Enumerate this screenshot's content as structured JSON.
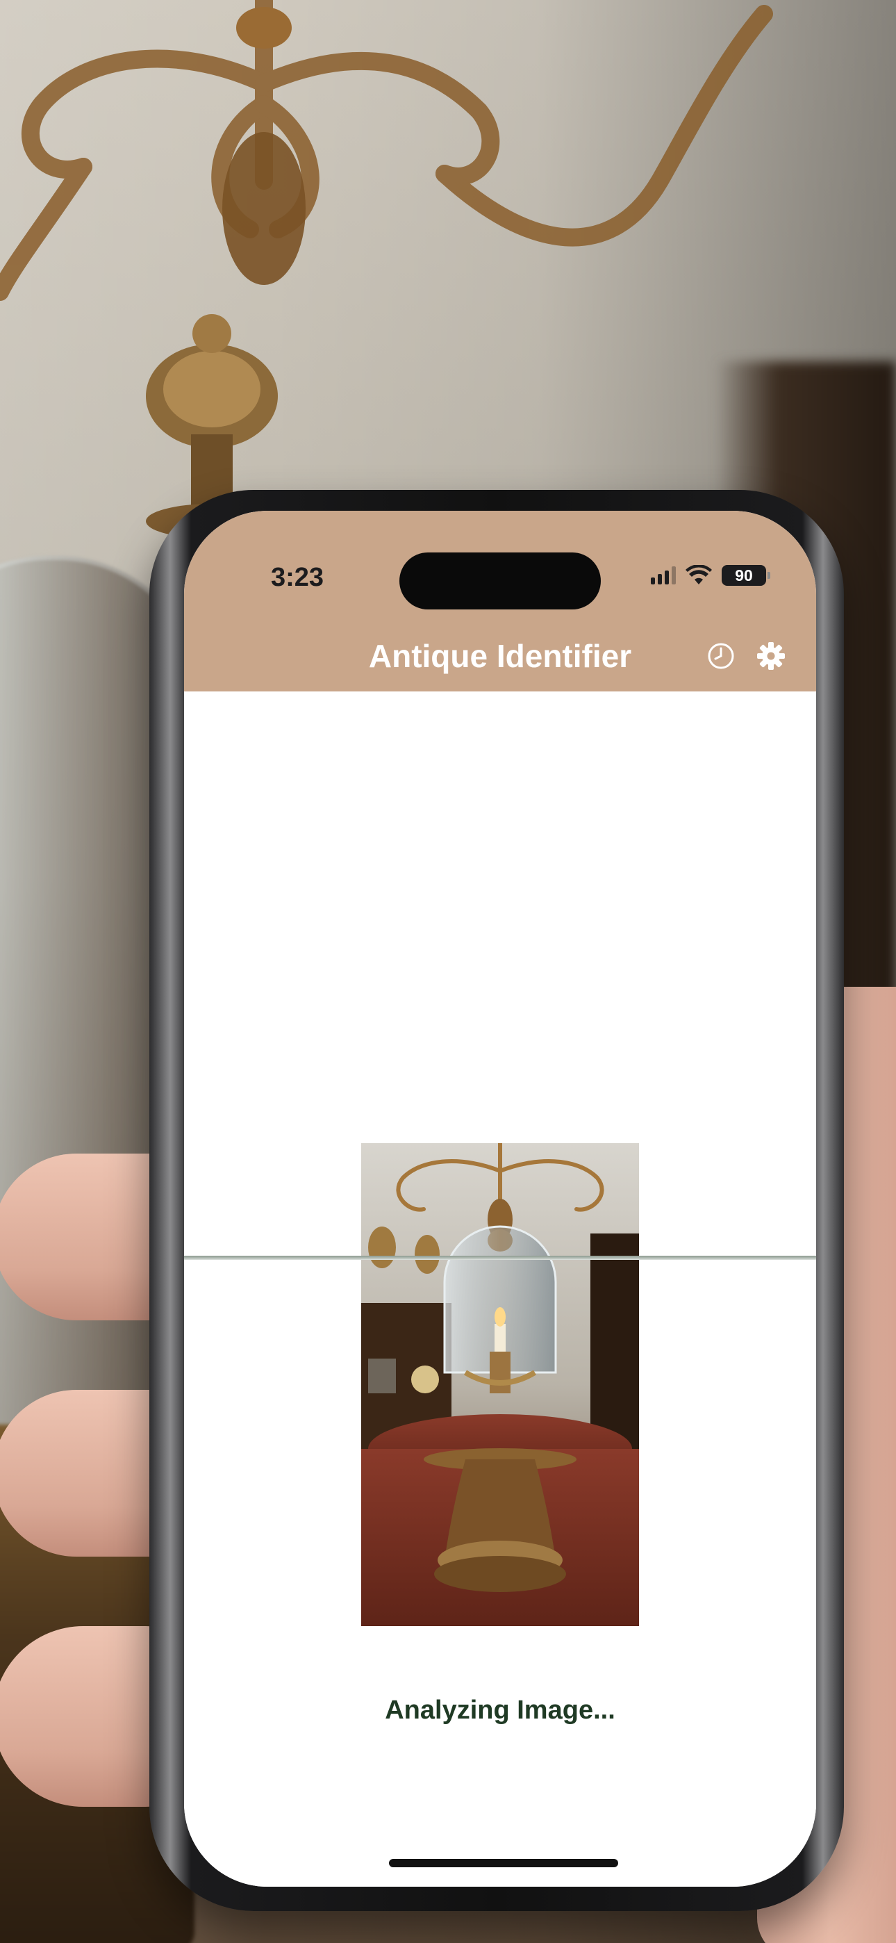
{
  "status_bar": {
    "time": "3:23",
    "battery": "90",
    "signal_icon": "cellular-signal-icon",
    "wifi_icon": "wifi-icon"
  },
  "app": {
    "title": "Antique Identifier",
    "accent_color": "#c9a68a",
    "history_icon": "clock-history-icon",
    "settings_icon": "gear-icon"
  },
  "main": {
    "status_text": "Analyzing Image...",
    "status_color": "#1f3a24"
  }
}
